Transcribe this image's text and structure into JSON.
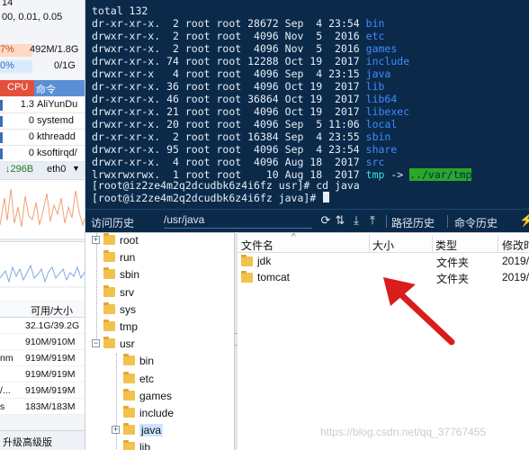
{
  "sidebar": {
    "top_line": "14",
    "load": "00, 0.01, 0.05",
    "mem_pct": "7%",
    "mem": "492M/1.8G",
    "swap_pct": "0%",
    "swap": "0/1G",
    "col_cpu": "CPU",
    "col_cmd": "命令",
    "processes": [
      {
        "cpu": "1.3",
        "cmd": "AliYunDu"
      },
      {
        "cpu": "0",
        "cmd": "systemd"
      },
      {
        "cpu": "0",
        "cmd": "kthreadd"
      },
      {
        "cpu": "0",
        "cmd": "ksoftirqd/"
      }
    ],
    "net_speed": "↓296B",
    "net_iface": "eth0",
    "net_dropdown": "▼",
    "disk_col_avail": "可用/大小",
    "disks": [
      {
        "name": "",
        "value": "32.1G/39.2G"
      },
      {
        "name": "",
        "value": "910M/910M"
      },
      {
        "name": "nm",
        "value": "919M/919M"
      },
      {
        "name": "",
        "value": "919M/919M"
      },
      {
        "name": "/...",
        "value": "919M/919M"
      },
      {
        "name": "s",
        "value": "183M/183M"
      }
    ],
    "upgrade": "升级高级版"
  },
  "terminal": {
    "total": "total 132",
    "entries": [
      {
        "perm": "dr-xr-xr-x.",
        "links": " 2",
        "user": "root",
        "group": "root",
        "size": "28672",
        "date": "Sep  4 23:54",
        "name": "bin",
        "link": false
      },
      {
        "perm": "drwxr-xr-x.",
        "links": " 2",
        "user": "root",
        "group": "root",
        "size": " 4096",
        "date": "Nov  5  2016",
        "name": "etc",
        "link": false
      },
      {
        "perm": "drwxr-xr-x.",
        "links": " 2",
        "user": "root",
        "group": "root",
        "size": " 4096",
        "date": "Nov  5  2016",
        "name": "games",
        "link": false
      },
      {
        "perm": "drwxr-xr-x.",
        "links": "74",
        "user": "root",
        "group": "root",
        "size": "12288",
        "date": "Oct 19  2017",
        "name": "include",
        "link": false
      },
      {
        "perm": "drwxr-xr-x ",
        "links": " 4",
        "user": "root",
        "group": "root",
        "size": " 4096",
        "date": "Sep  4 23:15",
        "name": "java",
        "link": false
      },
      {
        "perm": "dr-xr-xr-x.",
        "links": "36",
        "user": "root",
        "group": "root",
        "size": " 4096",
        "date": "Oct 19  2017",
        "name": "lib",
        "link": false
      },
      {
        "perm": "dr-xr-xr-x.",
        "links": "46",
        "user": "root",
        "group": "root",
        "size": "36864",
        "date": "Oct 19  2017",
        "name": "lib64",
        "link": false
      },
      {
        "perm": "drwxr-xr-x.",
        "links": "21",
        "user": "root",
        "group": "root",
        "size": " 4096",
        "date": "Oct 19  2017",
        "name": "libexec",
        "link": false
      },
      {
        "perm": "drwxr-xr-x.",
        "links": "20",
        "user": "root",
        "group": "root",
        "size": " 4096",
        "date": "Sep  5 11:06",
        "name": "local",
        "link": false
      },
      {
        "perm": "dr-xr-xr-x.",
        "links": " 2",
        "user": "root",
        "group": "root",
        "size": "16384",
        "date": "Sep  4 23:55",
        "name": "sbin",
        "link": false
      },
      {
        "perm": "drwxr-xr-x.",
        "links": "95",
        "user": "root",
        "group": "root",
        "size": " 4096",
        "date": "Sep  4 23:54",
        "name": "share",
        "link": false
      },
      {
        "perm": "drwxr-xr-x.",
        "links": " 4",
        "user": "root",
        "group": "root",
        "size": " 4096",
        "date": "Aug 18  2017",
        "name": "src",
        "link": false
      },
      {
        "perm": "lrwxrwxrwx.",
        "links": " 1",
        "user": "root",
        "group": "root",
        "size": "   10",
        "date": "Aug 18  2017",
        "name": "tmp",
        "link": true,
        "target": "../var/tmp"
      }
    ],
    "prompt1": "[root@iz2ze4m2q2dcudbk6z4i6fz usr]# cd java",
    "prompt2": "[root@iz2ze4m2q2dcudbk6z4i6fz java]# "
  },
  "toolbar": {
    "history": "访问历史",
    "path": "/usr/java",
    "path_history": "路径历史",
    "cmd_history": "命令历史",
    "icons": [
      "refresh-icon",
      "link-icon",
      "download-icon",
      "upload-icon"
    ]
  },
  "tree": {
    "items": [
      {
        "label": "root",
        "expander": "+"
      },
      {
        "label": "run",
        "expander": ""
      },
      {
        "label": "sbin",
        "expander": ""
      },
      {
        "label": "srv",
        "expander": ""
      },
      {
        "label": "sys",
        "expander": ""
      },
      {
        "label": "tmp",
        "expander": ""
      },
      {
        "label": "usr",
        "expander": "−"
      },
      {
        "label": "bin",
        "expander": ""
      },
      {
        "label": "etc",
        "expander": ""
      },
      {
        "label": "games",
        "expander": ""
      },
      {
        "label": "include",
        "expander": ""
      },
      {
        "label": "java",
        "expander": "+"
      },
      {
        "label": "lib",
        "expander": ""
      }
    ]
  },
  "files": {
    "columns": [
      "文件名",
      "大小",
      "类型",
      "修改时"
    ],
    "sort_indicator": "^",
    "rows": [
      {
        "name": "jdk",
        "size": "",
        "type": "文件夹",
        "modified": "2019/"
      },
      {
        "name": "tomcat",
        "size": "",
        "type": "文件夹",
        "modified": "2019/"
      }
    ]
  },
  "watermark": "https://blog.csdn.net/qq_37767455",
  "colors": {
    "terminal_bg": "#0b2a4a",
    "dir_name": "#3f8cff",
    "symlink": "#33e0e6",
    "link_target_bg": "#2aa82a",
    "arrow": "#d91c1c"
  }
}
